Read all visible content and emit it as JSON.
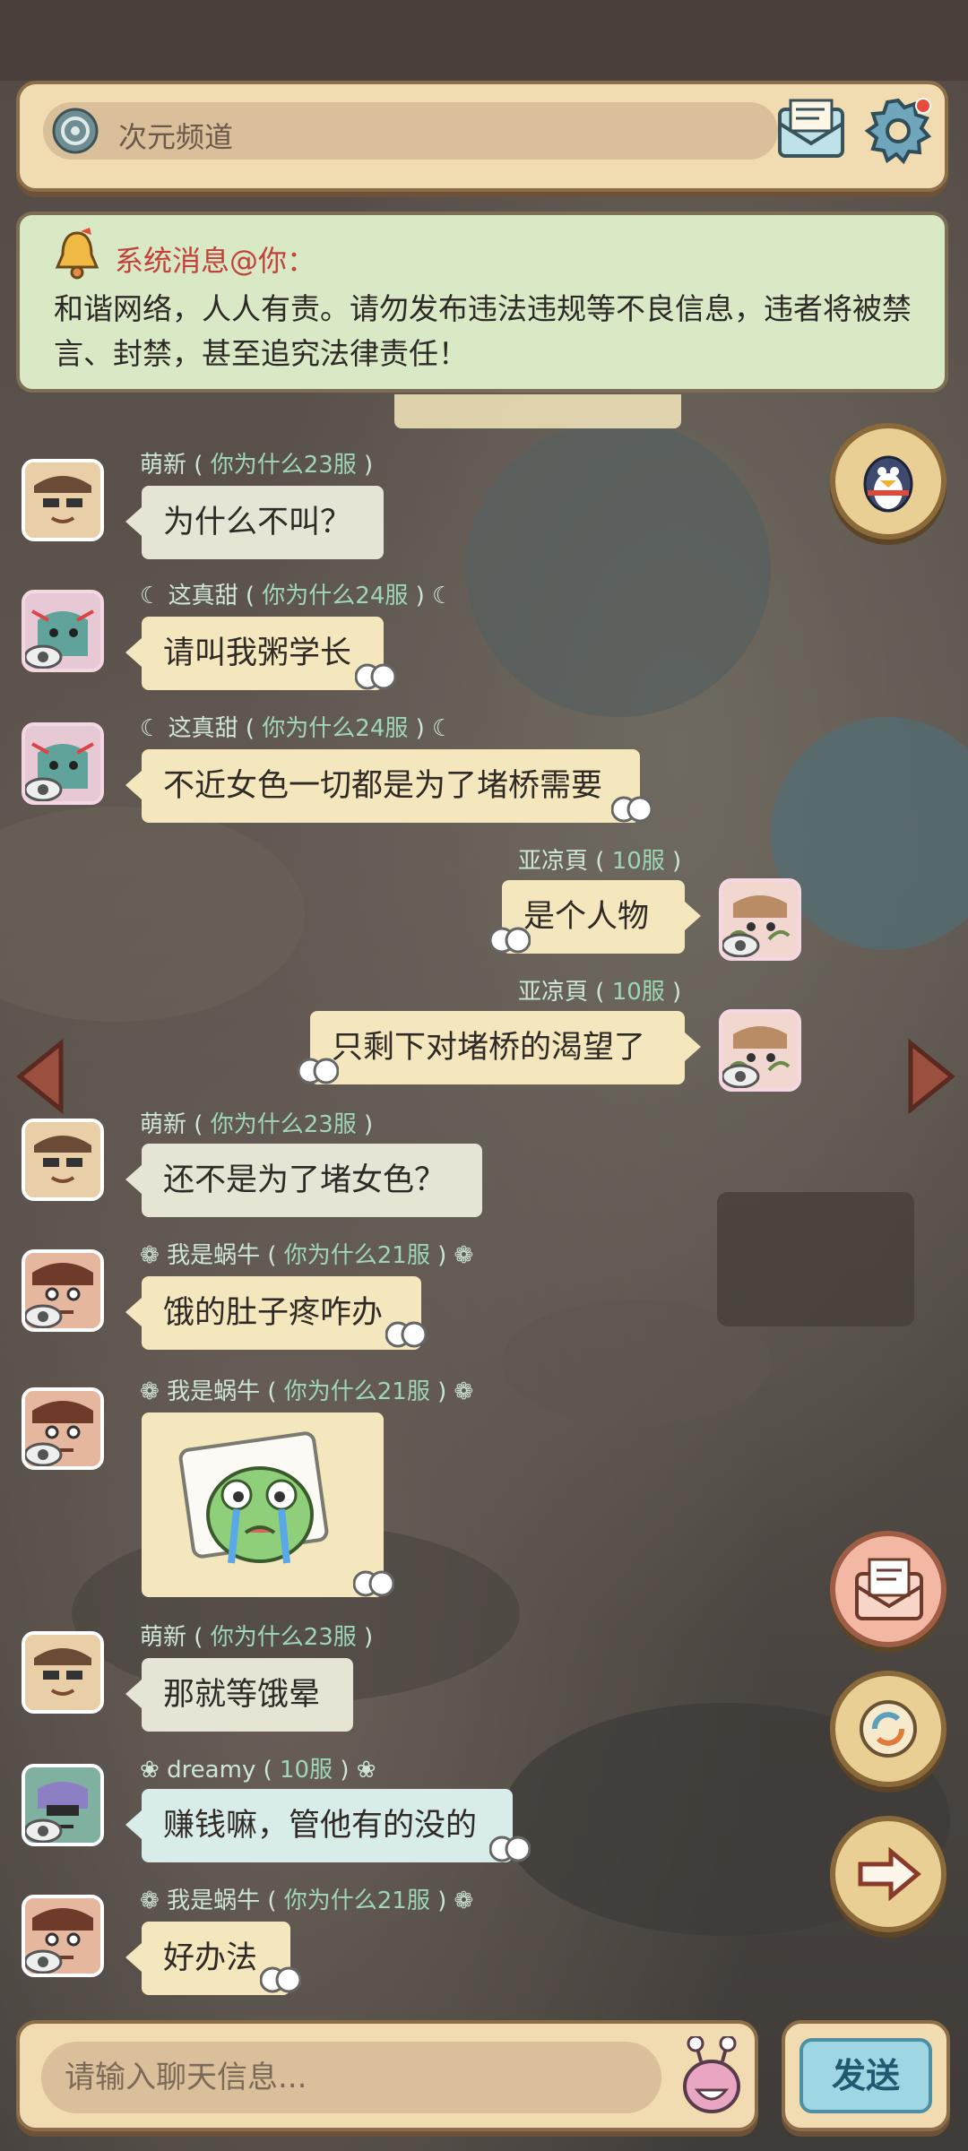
{
  "header": {
    "channel_name": "次元频道",
    "icons": [
      "channel-icon",
      "mail-icon",
      "settings-gear-icon"
    ]
  },
  "notice": {
    "title": "系统消息@你：",
    "body": "和谐网络，人人有责。请勿发布违法违规等不良信息，违者将被禁言、封禁，甚至追究法律责任！"
  },
  "messages": [
    {
      "user": "萌新",
      "server": "你为什么23服",
      "text": "为什么不叫？",
      "side": "left"
    },
    {
      "user": "这真甜",
      "server": "你为什么24服",
      "text": "请叫我粥学长",
      "side": "left"
    },
    {
      "user": "这真甜",
      "server": "你为什么24服",
      "text": "不近女色一切都是为了堵桥需要",
      "side": "left"
    },
    {
      "user": "亚凉頁",
      "server": "10服",
      "text": "是个人物",
      "side": "right"
    },
    {
      "user": "亚凉頁",
      "server": "10服",
      "text": "只剩下对堵桥的渴望了",
      "side": "right"
    },
    {
      "user": "萌新",
      "server": "你为什么23服",
      "text": "还不是为了堵女色？",
      "side": "left"
    },
    {
      "user": "我是蜗牛",
      "server": "你为什么21服",
      "text": "饿的肚子疼咋办",
      "side": "left"
    },
    {
      "user": "我是蜗牛",
      "server": "你为什么21服",
      "text": "",
      "sticker": "crying-frog-sticker",
      "side": "left"
    },
    {
      "user": "萌新",
      "server": "你为什么23服",
      "text": "那就等饿晕",
      "side": "left"
    },
    {
      "user": "dreamy",
      "server": "10服",
      "text": "赚钱嘛，管他有的没的",
      "side": "left"
    },
    {
      "user": "我是蜗牛",
      "server": "你为什么21服",
      "text": "好办法",
      "side": "left"
    }
  ],
  "input": {
    "placeholder": "请输入聊天信息..."
  },
  "send_label": "发送",
  "side_buttons": [
    "qq-penguin-icon",
    "letter-icon",
    "refresh-icon",
    "next-arrow-icon"
  ],
  "colors": {
    "panel": "#f1dbb0",
    "panel_border": "#8b6d4a",
    "notice_bg": "#d9e9c5",
    "notice_title": "#c2413b",
    "send_bg": "#9fd6e3"
  }
}
